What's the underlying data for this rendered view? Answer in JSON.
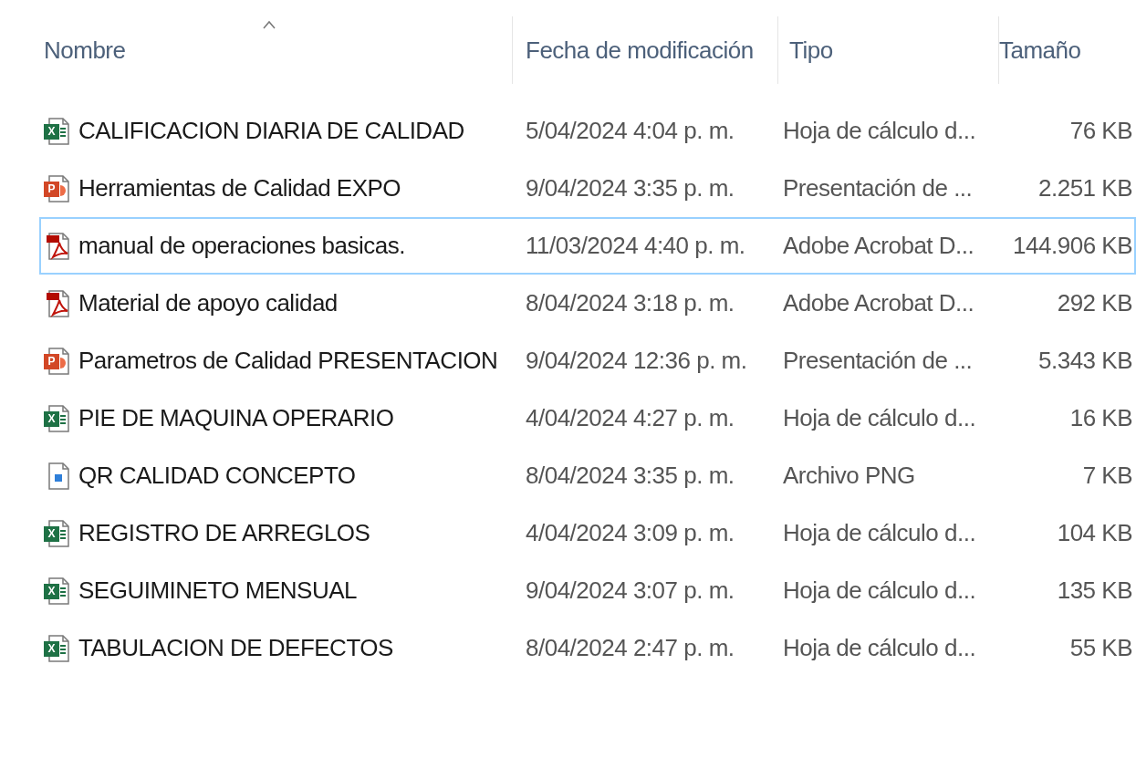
{
  "columns": [
    {
      "label": "Nombre",
      "sorted": true
    },
    {
      "label": "Fecha de modificación",
      "sorted": false
    },
    {
      "label": "Tipo",
      "sorted": false
    },
    {
      "label": "Tamaño",
      "sorted": false
    }
  ],
  "files": [
    {
      "kind": "excel",
      "icon_text": "X",
      "name": "CALIFICACION DIARIA DE CALIDAD",
      "date": "5/04/2024 4:04 p. m.",
      "type": "Hoja de cálculo d...",
      "size": "76 KB",
      "focused": false
    },
    {
      "kind": "powerpoint",
      "icon_text": "P",
      "name": "Herramientas de Calidad EXPO",
      "date": "9/04/2024 3:35 p. m.",
      "type": "Presentación de ...",
      "size": "2.251 KB",
      "focused": false
    },
    {
      "kind": "pdf",
      "name": "manual de operaciones basicas.",
      "date": "11/03/2024 4:40 p. m.",
      "type": "Adobe Acrobat D...",
      "size": "144.906 KB",
      "focused": true
    },
    {
      "kind": "pdf",
      "name": "Material de apoyo calidad",
      "date": "8/04/2024 3:18 p. m.",
      "type": "Adobe Acrobat D...",
      "size": "292 KB",
      "focused": false
    },
    {
      "kind": "powerpoint",
      "icon_text": "P",
      "name": "Parametros de Calidad PRESENTACION",
      "date": "9/04/2024 12:36 p. m.",
      "type": "Presentación de ...",
      "size": "5.343 KB",
      "focused": false
    },
    {
      "kind": "excel",
      "icon_text": "X",
      "name": "PIE DE MAQUINA OPERARIO",
      "date": "4/04/2024 4:27 p. m.",
      "type": "Hoja de cálculo d...",
      "size": "16 KB",
      "focused": false
    },
    {
      "kind": "image",
      "name": "QR CALIDAD CONCEPTO",
      "date": "8/04/2024 3:35 p. m.",
      "type": "Archivo PNG",
      "size": "7 KB",
      "focused": false
    },
    {
      "kind": "excel",
      "icon_text": "X",
      "name": "REGISTRO DE ARREGLOS",
      "date": "4/04/2024 3:09 p. m.",
      "type": "Hoja de cálculo d...",
      "size": "104 KB",
      "focused": false
    },
    {
      "kind": "excel",
      "icon_text": "X",
      "name": "SEGUIMINETO MENSUAL",
      "date": "9/04/2024 3:07 p. m.",
      "type": "Hoja de cálculo d...",
      "size": "135 KB",
      "focused": false
    },
    {
      "kind": "excel",
      "icon_text": "X",
      "name": "TABULACION DE DEFECTOS",
      "date": "8/04/2024 2:47 p. m.",
      "type": "Hoja de cálculo d...",
      "size": "55 KB",
      "focused": false
    }
  ]
}
